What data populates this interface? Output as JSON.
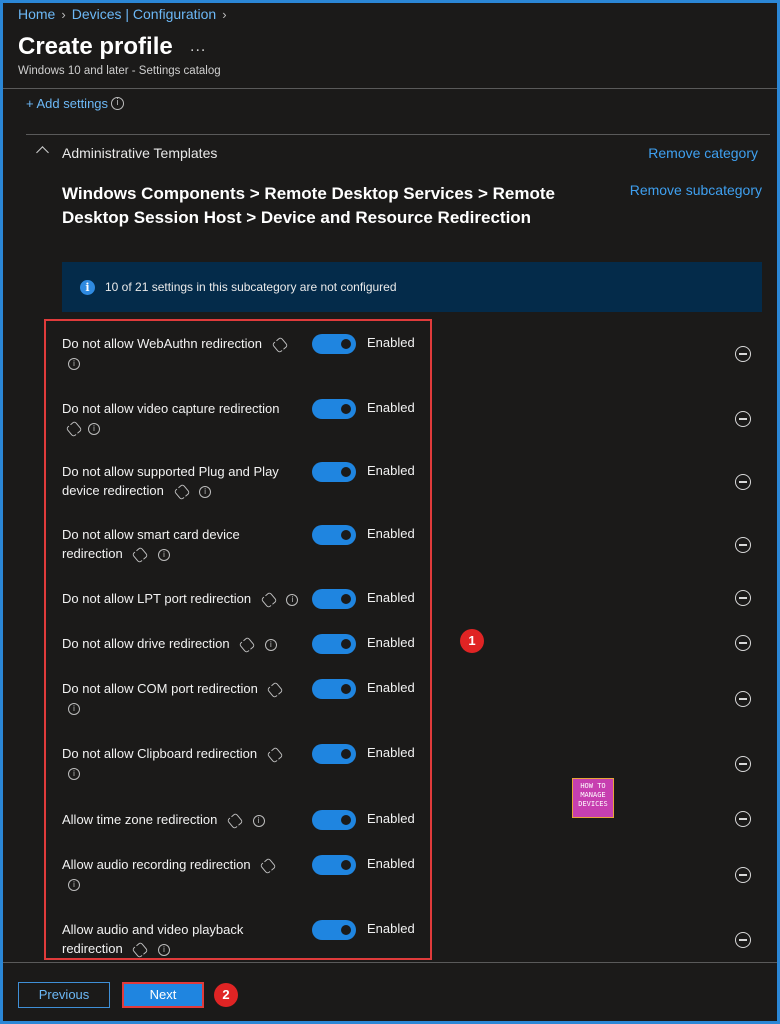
{
  "breadcrumb": {
    "items": [
      "Home",
      "Devices | Configuration"
    ]
  },
  "header": {
    "title": "Create profile",
    "more": "...",
    "subtitle": "Windows 10 and later - Settings catalog"
  },
  "add_settings": "+ Add settings",
  "category": {
    "name": "Administrative Templates",
    "remove_label": "Remove category"
  },
  "subcategory": {
    "path": "Windows Components > Remote Desktop Services > Remote Desktop Session Host > Device and Resource Redirection",
    "remove_label": "Remove subcategory"
  },
  "banner": {
    "text": "10 of 21 settings in this subcategory are not configured"
  },
  "settings": [
    {
      "label": "Do not allow WebAuthn redirection",
      "value": "Enabled"
    },
    {
      "label": "Do not allow video capture redirection",
      "value": "Enabled"
    },
    {
      "label": "Do not allow supported Plug and Play device redirection",
      "value": "Enabled"
    },
    {
      "label": "Do not allow smart card device redirection",
      "value": "Enabled"
    },
    {
      "label": "Do not allow LPT port redirection",
      "value": "Enabled"
    },
    {
      "label": "Do not allow drive redirection",
      "value": "Enabled"
    },
    {
      "label": "Do not allow COM port redirection",
      "value": "Enabled"
    },
    {
      "label": "Do not allow Clipboard redirection",
      "value": "Enabled"
    },
    {
      "label": "Allow time zone redirection",
      "value": "Enabled"
    },
    {
      "label": "Allow audio recording redirection",
      "value": "Enabled"
    },
    {
      "label": "Allow audio and video playback redirection",
      "value": "Enabled"
    }
  ],
  "annotations": {
    "badge1": "1",
    "badge2": "2"
  },
  "logo": {
    "line1": "HOW TO",
    "line2": "MANAGE",
    "line3": "DEVICES"
  },
  "footer": {
    "previous_label": "Previous",
    "next_label": "Next"
  },
  "colors": {
    "accent": "#1f85e0",
    "link": "#6cb8f6",
    "highlight": "#e03b3b",
    "background": "#1b1a19"
  }
}
